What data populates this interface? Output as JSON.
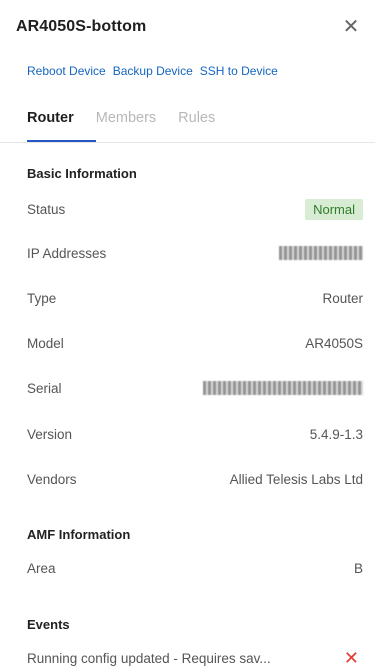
{
  "panel": {
    "title": "AR4050S-bottom",
    "close_icon": "close-icon"
  },
  "actions": [
    {
      "label": "Reboot Device"
    },
    {
      "label": "Backup Device"
    },
    {
      "label": "SSH to Device"
    }
  ],
  "tabs": [
    {
      "label": "Router",
      "active": true
    },
    {
      "label": "Members",
      "active": false
    },
    {
      "label": "Rules",
      "active": false
    }
  ],
  "basic_info": {
    "title": "Basic Information",
    "rows": [
      {
        "label": "Status",
        "value": "Normal"
      },
      {
        "label": "IP Addresses",
        "value": ""
      },
      {
        "label": "Type",
        "value": "Router"
      },
      {
        "label": "Model",
        "value": "AR4050S"
      },
      {
        "label": "Serial",
        "value": ""
      },
      {
        "label": "Version",
        "value": "5.4.9-1.3"
      },
      {
        "label": "Vendors",
        "value": "Allied Telesis Labs Ltd"
      }
    ],
    "status_color": "#2f7d2b",
    "status_bg": "#d7ecd2"
  },
  "amf_info": {
    "title": "AMF Information",
    "rows": [
      {
        "label": "Area",
        "value": "B"
      }
    ]
  },
  "events": {
    "title": "Events",
    "items": [
      {
        "text": "Running config updated - Requires sav...",
        "dismiss_icon": "close-icon"
      }
    ]
  },
  "colors": {
    "accent": "#2558c5",
    "link": "#1565c0",
    "danger": "#e53935"
  }
}
